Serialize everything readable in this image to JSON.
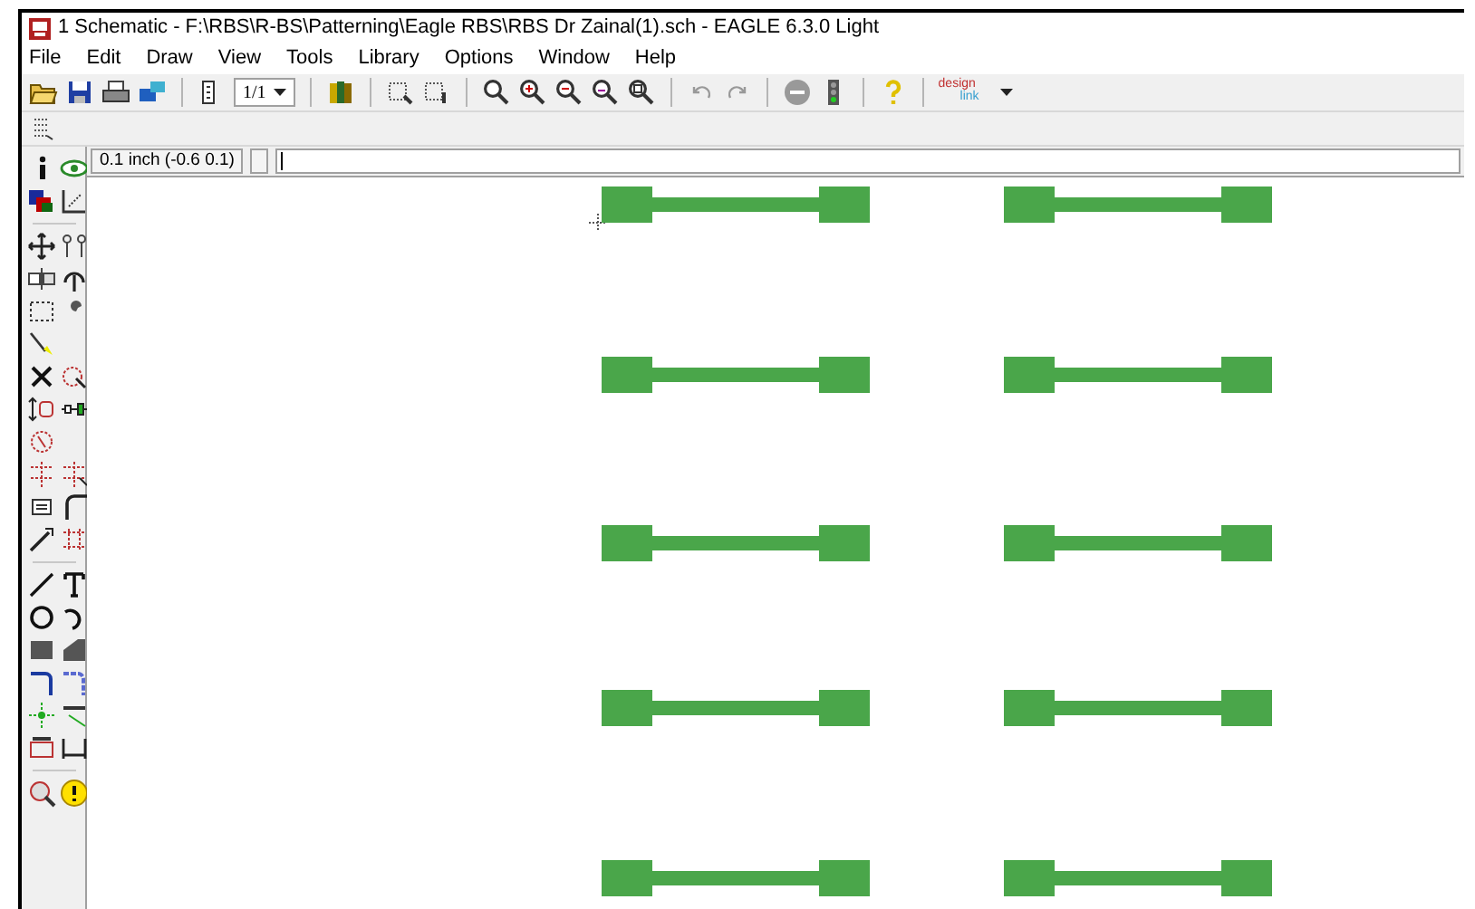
{
  "window": {
    "title": "1 Schematic - F:\\RBS\\R-BS\\Patterning\\Eagle RBS\\RBS Dr Zainal(1).sch - EAGLE 6.3.0 Light"
  },
  "menu": [
    "File",
    "Edit",
    "Draw",
    "View",
    "Tools",
    "Library",
    "Options",
    "Window",
    "Help"
  ],
  "toolbar": {
    "sheet_select": "1/1",
    "logo_top": "design",
    "logo_bottom": "link"
  },
  "command_bar": {
    "grid_info": "0.1 inch (-0.6 0.1)"
  }
}
